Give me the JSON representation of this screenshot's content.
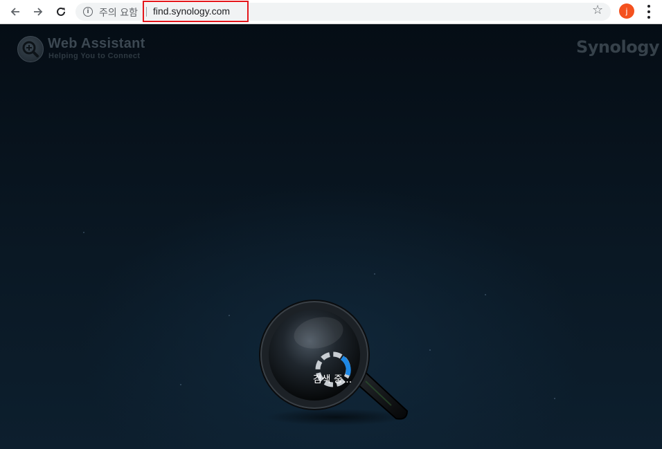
{
  "browser": {
    "security_label": "주의 요함",
    "url": "find.synology.com",
    "profile_initial": "j",
    "icons": {
      "back": "arrow-left-icon",
      "forward": "arrow-right-icon",
      "reload": "reload-icon",
      "info": "info-icon",
      "bookmark": "star-icon",
      "menu": "more-vert-icon"
    },
    "colors": {
      "highlight": "#e4161b",
      "avatar": "#f4511e"
    }
  },
  "page": {
    "logo": {
      "title": "Web Assistant",
      "subtitle": "Helping You to Connect"
    },
    "brand": "Synology",
    "status": "검색 중..."
  }
}
